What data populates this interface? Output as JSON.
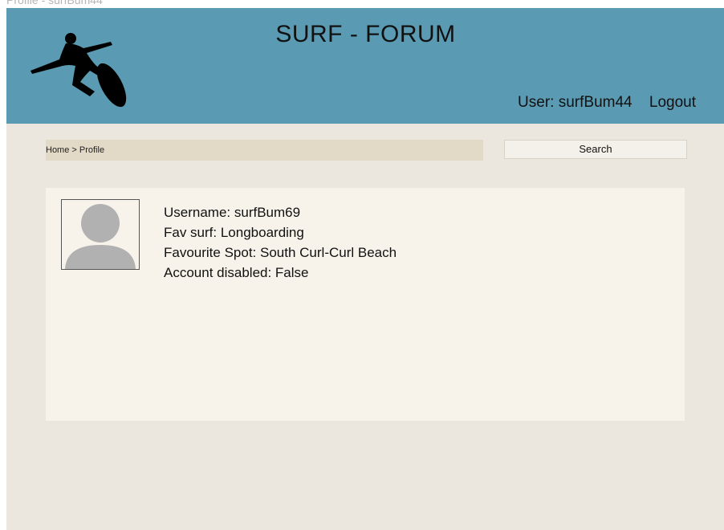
{
  "window": {
    "caption": "Profile - surfBum44"
  },
  "header": {
    "title": "SURF - FORUM",
    "user_label": "User: surfBum44",
    "logout_label": "Logout"
  },
  "nav": {
    "breadcrumb": "Home > Profile",
    "search_label": "Search"
  },
  "profile": {
    "username": "Username: surfBum69",
    "fav_surf": "Fav surf: Longboarding",
    "favourite_spot": "Favourite Spot: South Curl-Curl Beach",
    "account_disabled": "Account disabled: False"
  },
  "colors": {
    "header_bg": "#5a9bb3",
    "page_bg": "#ebe7de",
    "card_bg": "#f7f3ea",
    "breadcrumb_bg": "#e2d9c6"
  },
  "icons": {
    "logo": "surfer-silhouette-icon",
    "avatar": "default-user-avatar-icon"
  }
}
